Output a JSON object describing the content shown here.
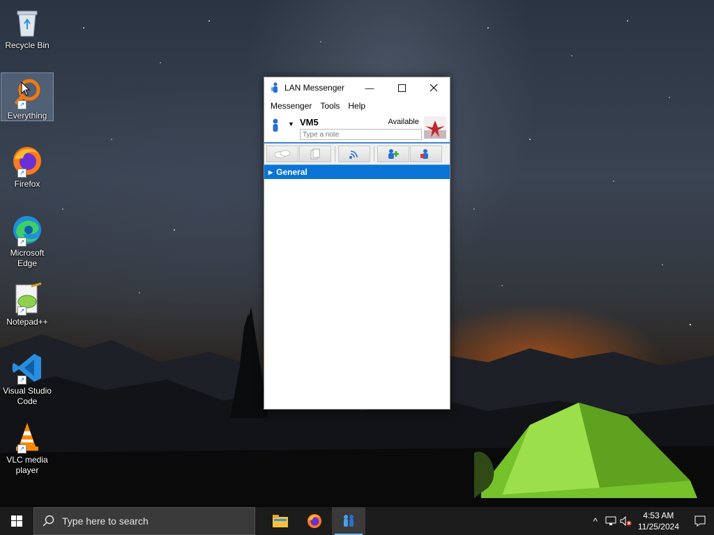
{
  "desktop": {
    "icons": [
      {
        "label": "Recycle Bin"
      },
      {
        "label": "Everything"
      },
      {
        "label": "Firefox"
      },
      {
        "label": "Microsoft Edge"
      },
      {
        "label": "Notepad++"
      },
      {
        "label": "Visual Studio Code"
      },
      {
        "label": "VLC media player"
      }
    ]
  },
  "window": {
    "title": "LAN Messenger",
    "menu": [
      "Messenger",
      "Tools",
      "Help"
    ],
    "username": "VM5",
    "status": "Available",
    "note_placeholder": "Type a note",
    "group": "General"
  },
  "taskbar": {
    "search_placeholder": "Type here to search",
    "time": "4:53 AM",
    "date": "11/25/2024"
  },
  "colors": {
    "accent": "#0a74d6",
    "taskbar": "#1c1c1c"
  }
}
